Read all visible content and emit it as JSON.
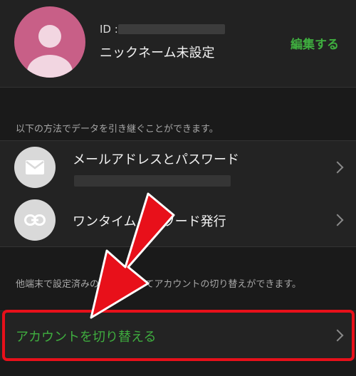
{
  "profile": {
    "id_label": "ID :",
    "nickname": "ニックネーム未設定",
    "edit_label": "編集する"
  },
  "transfer": {
    "note": "以下の方法でデータを引き継ぐことができます。",
    "email_label": "メールアドレスとパスワード",
    "email_icon": "envelope-icon",
    "otp_label": "ワンタイムパスワード発行",
    "otp_icon": "link-icon"
  },
  "switch_account": {
    "note": "他端末で設定済みの方法を使ってアカウントの切り替えができます。",
    "label": "アカウントを切り替える"
  },
  "colors": {
    "background": "#1a1a1a",
    "accent_green": "#3fae3f",
    "annotation_red": "#e8101a",
    "avatar_pink": "#c85f87"
  }
}
